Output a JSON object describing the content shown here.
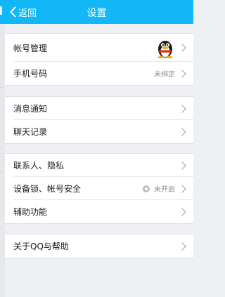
{
  "header": {
    "back_label": "返回",
    "title": "设置"
  },
  "groups": [
    {
      "rows": [
        {
          "label": "帐号管理",
          "value": "",
          "avatar": "qq-penguin-avatar"
        },
        {
          "label": "手机号码",
          "value": "未绑定"
        }
      ]
    },
    {
      "rows": [
        {
          "label": "消息通知",
          "value": ""
        },
        {
          "label": "聊天记录",
          "value": ""
        }
      ]
    },
    {
      "rows": [
        {
          "label": "联系人、隐私",
          "value": ""
        },
        {
          "label": "设备锁、帐号安全",
          "value": "未开启",
          "icon": "lock-icon"
        },
        {
          "label": "辅助功能",
          "value": ""
        }
      ]
    },
    {
      "rows": [
        {
          "label": "关于QQ与帮助",
          "value": ""
        }
      ]
    }
  ],
  "colors": {
    "header": "#12b7f5",
    "background": "#eef0f4"
  }
}
